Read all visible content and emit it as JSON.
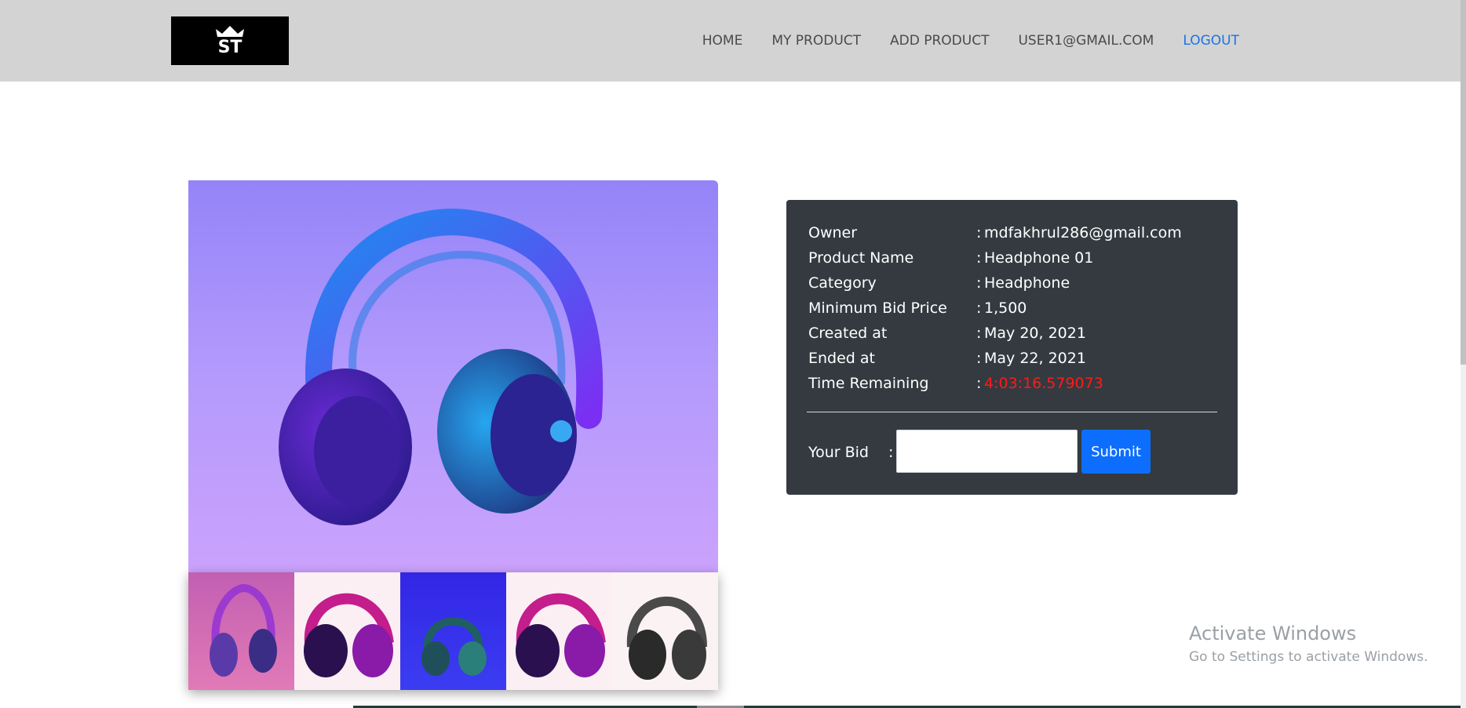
{
  "nav": {
    "logo_alt": "ST",
    "links": [
      "HOME",
      "MY PRODUCT",
      "ADD PRODUCT",
      "USER1@GMAIL.COM"
    ],
    "logout": "LOGOUT"
  },
  "product": {
    "main_image": "headphone-image",
    "thumbnails": [
      "headphone-pink-thumb",
      "headphone-magenta-thumb",
      "headphone-blue-thumb",
      "headphone-magenta-2-thumb",
      "headphone-black-thumb"
    ]
  },
  "details": {
    "rows": [
      {
        "label": "Owner",
        "value": "mdfakhrul286@gmail.com"
      },
      {
        "label": "Product Name",
        "value": "Headphone 01"
      },
      {
        "label": "Category",
        "value": "Headphone"
      },
      {
        "label": "Minimum Bid Price",
        "value": "1,500"
      },
      {
        "label": "Created at",
        "value": "May 20, 2021"
      },
      {
        "label": "Ended at",
        "value": "May 22, 2021"
      },
      {
        "label": "Time Remaining",
        "value": "4:03:16.579073"
      }
    ],
    "colon": ":"
  },
  "bid": {
    "label": "Your Bid",
    "colon": ":",
    "input_value": "",
    "submit_label": "Submit"
  },
  "watermark": {
    "title": "Activate Windows",
    "subtitle": "Go to Settings to activate Windows."
  },
  "colors": {
    "navbar": "#d3d3d3",
    "card": "#343a40",
    "accent": "#0d6efd",
    "timer": "#ff1a1a",
    "logout": "#1a73e8"
  }
}
